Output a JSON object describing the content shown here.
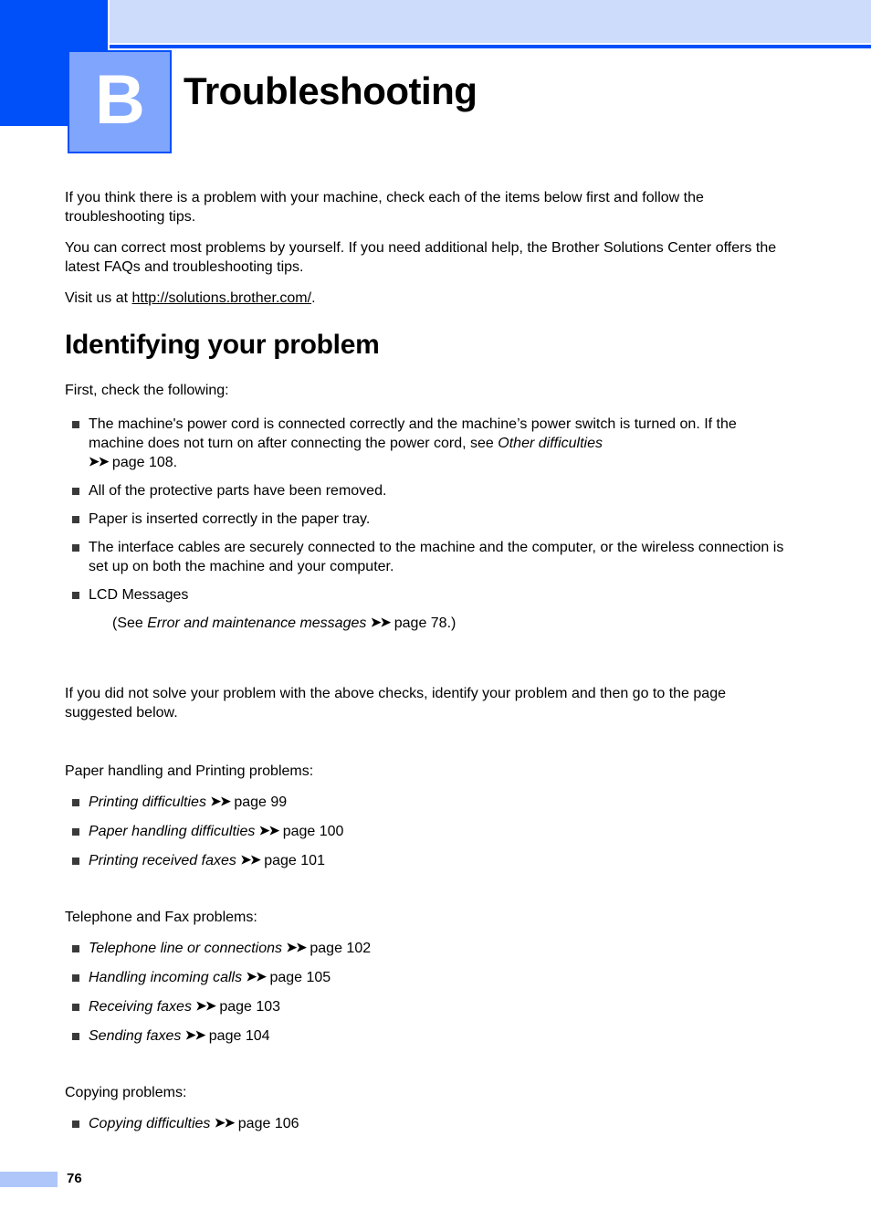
{
  "header": {
    "chapter_letter": "B",
    "chapter_title": "Troubleshooting"
  },
  "intro": {
    "paragraph1": "If you think there is a problem with your machine, check each of the items below first and follow the troubleshooting tips.",
    "paragraph2": "You can correct most problems by yourself. If you need additional help, the Brother Solutions Center offers the latest FAQs and troubleshooting tips.",
    "visit_prefix": "Visit us at ",
    "visit_url": "http://solutions.brother.com/",
    "visit_suffix": "."
  },
  "section": {
    "heading": "Identifying your problem",
    "lead": "First, check the following:",
    "checks": [
      {
        "text_before": "The machine's power cord is connected correctly and the machine’s power switch is turned on. If the machine does not turn on after connecting the power cord, see ",
        "italic": "Other difficulties",
        "chevron": "➤➤",
        "page": " page 108."
      },
      {
        "text_before": "All of the protective parts have been removed.",
        "italic": "",
        "chevron": "",
        "page": ""
      },
      {
        "text_before": "Paper is inserted correctly in the paper tray.",
        "italic": "",
        "chevron": "",
        "page": ""
      },
      {
        "text_before": "The interface cables are securely connected to the machine and the computer, or the wireless connection is set up on both the machine and your computer.",
        "italic": "",
        "chevron": "",
        "page": ""
      },
      {
        "text_before": "LCD Messages",
        "italic": "",
        "chevron": "",
        "page": ""
      }
    ],
    "lcd_note": {
      "prefix": "(See ",
      "italic": "Error and maintenance messages",
      "chevron": "➤➤",
      "suffix": " page 78.)"
    },
    "closing": "If you did not solve your problem with the above checks, identify your problem and then go to the page suggested below."
  },
  "groups": [
    {
      "label": "Paper handling and Printing problems:",
      "items": [
        {
          "title": "Printing difficulties",
          "chevron": "➤➤",
          "page": " page 99"
        },
        {
          "title": "Paper handling difficulties",
          "chevron": "➤➤",
          "page": " page 100"
        },
        {
          "title": "Printing received faxes",
          "chevron": "➤➤",
          "page": " page 101"
        }
      ]
    },
    {
      "label": "Telephone and Fax problems:",
      "items": [
        {
          "title": "Telephone line or connections",
          "chevron": "➤➤",
          "page": " page 102"
        },
        {
          "title": "Handling incoming calls",
          "chevron": "➤➤",
          "page": " page 105"
        },
        {
          "title": "Receiving faxes",
          "chevron": "➤➤",
          "page": " page 103"
        },
        {
          "title": "Sending faxes",
          "chevron": "➤➤",
          "page": " page 104"
        }
      ]
    },
    {
      "label": "Copying problems:",
      "items": [
        {
          "title": "Copying difficulties",
          "chevron": "➤➤",
          "page": " page 106"
        }
      ]
    }
  ],
  "footer": {
    "page_number": "76"
  },
  "colors": {
    "accent_dark_blue": "#0050fa",
    "accent_light_blue": "#ccdcfa",
    "badge_blue": "#80a5fc",
    "footer_bar_blue": "#aec6fa",
    "bullet_gray": "#3a3a3a"
  }
}
